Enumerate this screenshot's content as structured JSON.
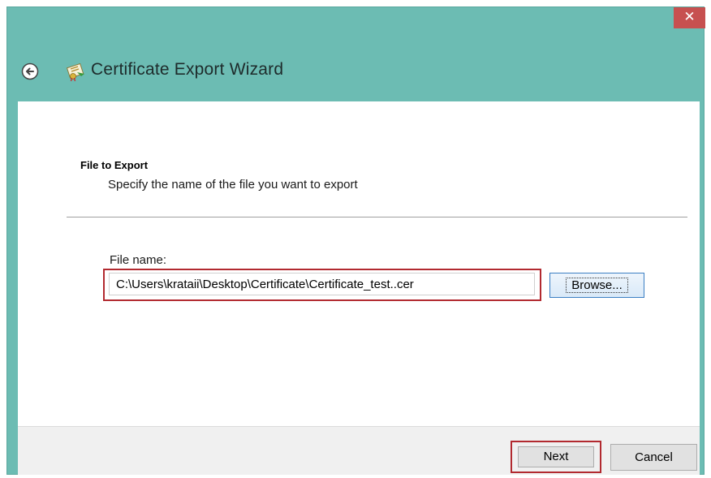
{
  "window": {
    "close_glyph": "✕",
    "title": "Certificate Export Wizard",
    "accent_color": "#6cbcb3",
    "highlight_color": "#b22a30"
  },
  "icons": {
    "back": "back-arrow-icon",
    "title": "certificate-icon",
    "close": "close-icon"
  },
  "section": {
    "title": "File to Export",
    "description": "Specify the name of the file you want to export"
  },
  "file_field": {
    "label": "File name:",
    "value": "C:\\Users\\krataii\\Desktop\\Certificate\\Certificate_test..cer"
  },
  "buttons": {
    "browse": "Browse...",
    "next": "Next",
    "cancel": "Cancel"
  }
}
